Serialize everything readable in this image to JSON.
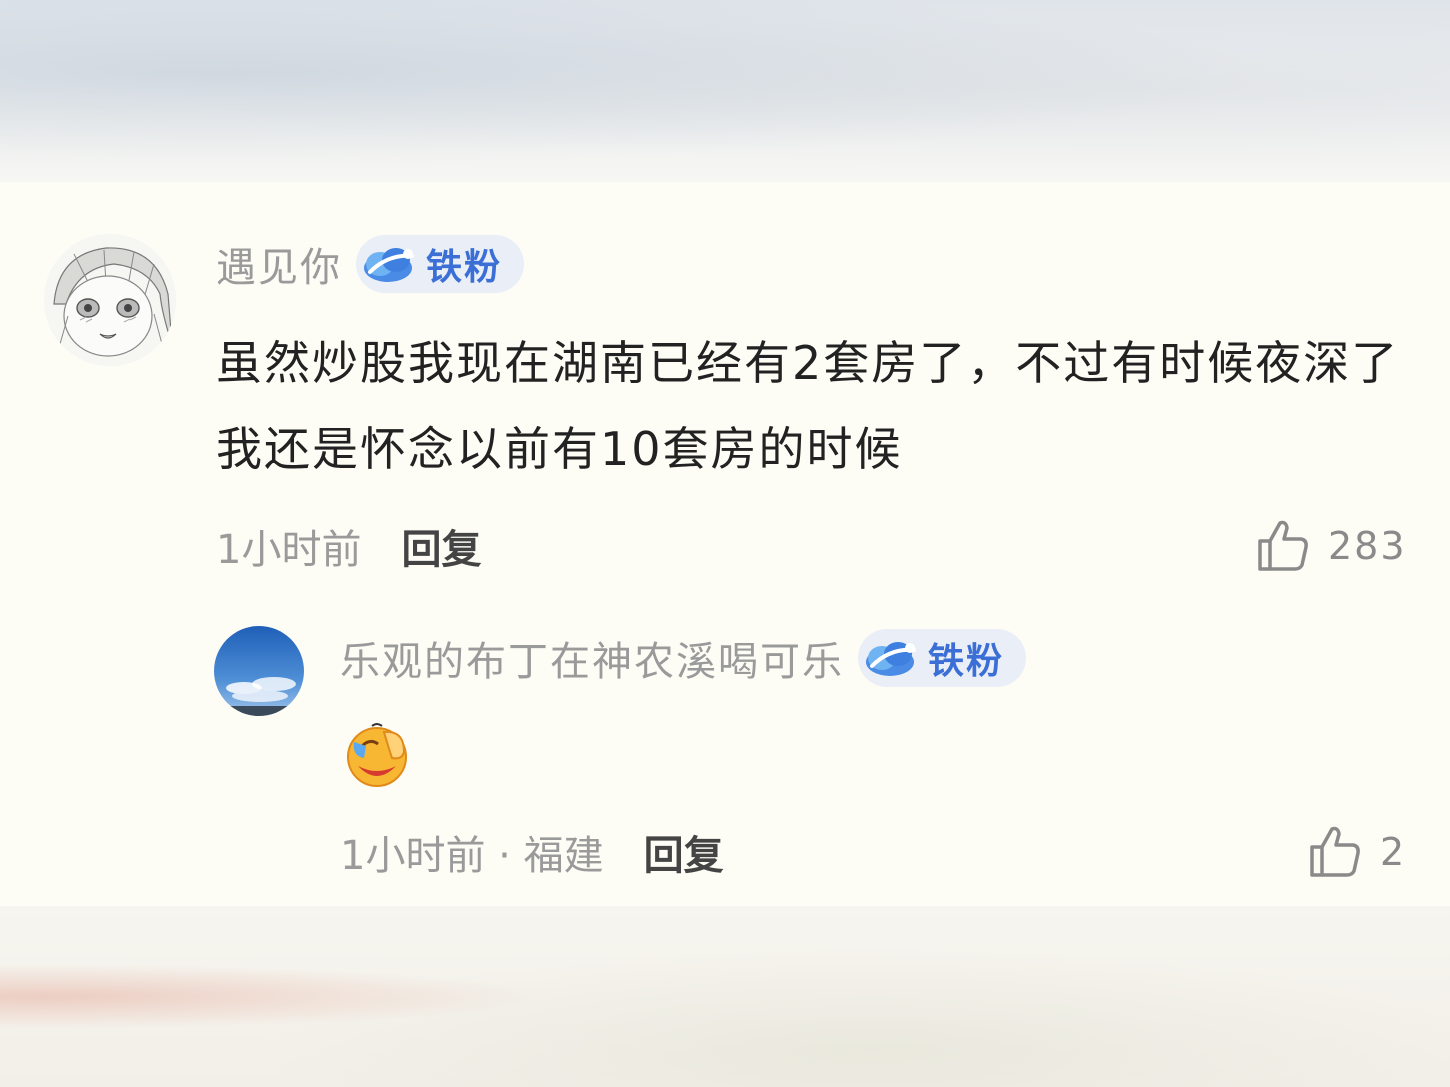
{
  "comment": {
    "username": "遇见你",
    "badge": {
      "icon": "fan-cloud-icon",
      "label": "铁粉"
    },
    "text": "虽然炒股我现在湖南已经有2套房了，不过有时候夜深了我还是怀念以前有10套房的时候",
    "time": "1小时前",
    "reply_label": "回复",
    "like_icon": "thumbs-up-icon",
    "likes": "283"
  },
  "reply": {
    "username": "乐观的布丁在神农溪喝可乐",
    "badge": {
      "icon": "fan-cloud-icon",
      "label": "铁粉"
    },
    "emoji": "facepalm-laugh-emoji",
    "time": "1小时前 · 福建",
    "reply_label": "回复",
    "like_icon": "thumbs-up-icon",
    "likes": "2"
  },
  "colors": {
    "background": "#fdfdf6",
    "username": "#9a9a9a",
    "text": "#222222",
    "badge_bg": "#e9eef7",
    "badge_text": "#3b6fd6"
  }
}
